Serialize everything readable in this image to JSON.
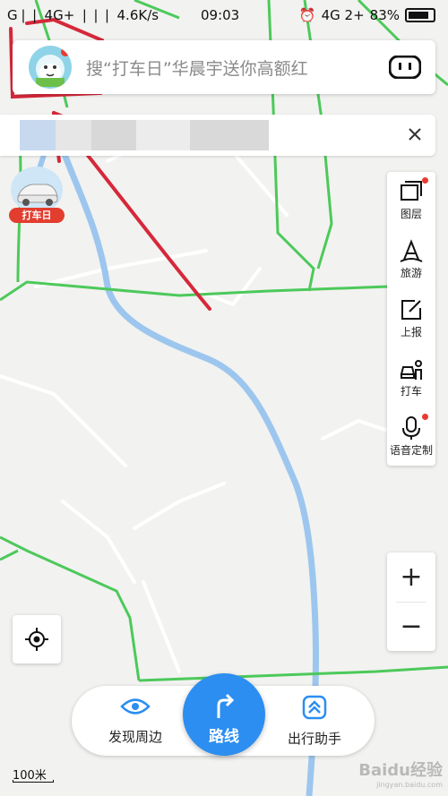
{
  "status_bar": {
    "left": "G❘❘ 4G+ ❘❘❘ 4.6K/s",
    "time": "09:03",
    "network": "4G 2+",
    "battery": "83%",
    "battery_level": 0.83
  },
  "search": {
    "placeholder": "搜“打车日”华晨宇送你高额红"
  },
  "taxi_badge": {
    "label": "打车日"
  },
  "tools": [
    {
      "label": "图层",
      "icon": "layers-icon"
    },
    {
      "label": "旅游",
      "icon": "travel-icon"
    },
    {
      "label": "上报",
      "icon": "report-icon"
    },
    {
      "label": "打车",
      "icon": "taxi-icon"
    },
    {
      "label": "语音定制",
      "icon": "mic-icon"
    }
  ],
  "zoom": {
    "in": "+",
    "out": "−"
  },
  "bottom": {
    "discover": "发现周边",
    "route": "路线",
    "assistant": "出行助手"
  },
  "scale": "100米",
  "watermark": {
    "title": "Baidu经验",
    "sub": "jingyan.baidu.com"
  },
  "colors": {
    "accent": "#2b8ef0",
    "road_green": "#4cc95a",
    "river": "#9cc6ee",
    "annotation": "#d6283a"
  }
}
